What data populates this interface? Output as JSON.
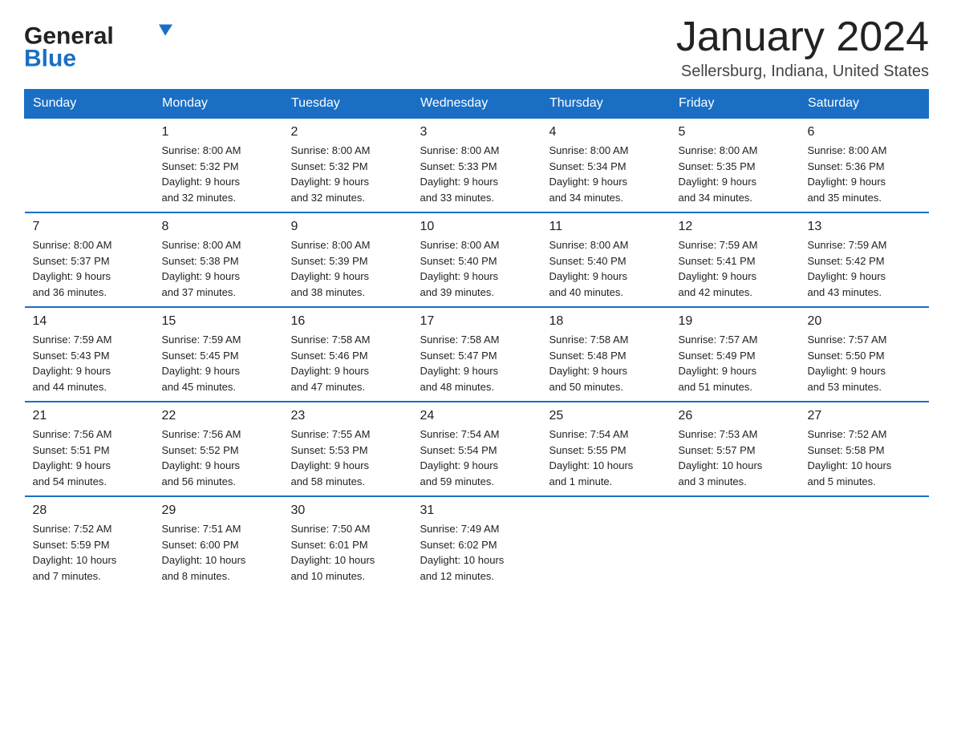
{
  "header": {
    "logo_general": "General",
    "logo_blue": "Blue",
    "month_title": "January 2024",
    "location": "Sellersburg, Indiana, United States"
  },
  "calendar": {
    "days_of_week": [
      "Sunday",
      "Monday",
      "Tuesday",
      "Wednesday",
      "Thursday",
      "Friday",
      "Saturday"
    ],
    "weeks": [
      [
        {
          "day": "",
          "info": ""
        },
        {
          "day": "1",
          "info": "Sunrise: 8:00 AM\nSunset: 5:32 PM\nDaylight: 9 hours\nand 32 minutes."
        },
        {
          "day": "2",
          "info": "Sunrise: 8:00 AM\nSunset: 5:32 PM\nDaylight: 9 hours\nand 32 minutes."
        },
        {
          "day": "3",
          "info": "Sunrise: 8:00 AM\nSunset: 5:33 PM\nDaylight: 9 hours\nand 33 minutes."
        },
        {
          "day": "4",
          "info": "Sunrise: 8:00 AM\nSunset: 5:34 PM\nDaylight: 9 hours\nand 34 minutes."
        },
        {
          "day": "5",
          "info": "Sunrise: 8:00 AM\nSunset: 5:35 PM\nDaylight: 9 hours\nand 34 minutes."
        },
        {
          "day": "6",
          "info": "Sunrise: 8:00 AM\nSunset: 5:36 PM\nDaylight: 9 hours\nand 35 minutes."
        }
      ],
      [
        {
          "day": "7",
          "info": "Sunrise: 8:00 AM\nSunset: 5:37 PM\nDaylight: 9 hours\nand 36 minutes."
        },
        {
          "day": "8",
          "info": "Sunrise: 8:00 AM\nSunset: 5:38 PM\nDaylight: 9 hours\nand 37 minutes."
        },
        {
          "day": "9",
          "info": "Sunrise: 8:00 AM\nSunset: 5:39 PM\nDaylight: 9 hours\nand 38 minutes."
        },
        {
          "day": "10",
          "info": "Sunrise: 8:00 AM\nSunset: 5:40 PM\nDaylight: 9 hours\nand 39 minutes."
        },
        {
          "day": "11",
          "info": "Sunrise: 8:00 AM\nSunset: 5:40 PM\nDaylight: 9 hours\nand 40 minutes."
        },
        {
          "day": "12",
          "info": "Sunrise: 7:59 AM\nSunset: 5:41 PM\nDaylight: 9 hours\nand 42 minutes."
        },
        {
          "day": "13",
          "info": "Sunrise: 7:59 AM\nSunset: 5:42 PM\nDaylight: 9 hours\nand 43 minutes."
        }
      ],
      [
        {
          "day": "14",
          "info": "Sunrise: 7:59 AM\nSunset: 5:43 PM\nDaylight: 9 hours\nand 44 minutes."
        },
        {
          "day": "15",
          "info": "Sunrise: 7:59 AM\nSunset: 5:45 PM\nDaylight: 9 hours\nand 45 minutes."
        },
        {
          "day": "16",
          "info": "Sunrise: 7:58 AM\nSunset: 5:46 PM\nDaylight: 9 hours\nand 47 minutes."
        },
        {
          "day": "17",
          "info": "Sunrise: 7:58 AM\nSunset: 5:47 PM\nDaylight: 9 hours\nand 48 minutes."
        },
        {
          "day": "18",
          "info": "Sunrise: 7:58 AM\nSunset: 5:48 PM\nDaylight: 9 hours\nand 50 minutes."
        },
        {
          "day": "19",
          "info": "Sunrise: 7:57 AM\nSunset: 5:49 PM\nDaylight: 9 hours\nand 51 minutes."
        },
        {
          "day": "20",
          "info": "Sunrise: 7:57 AM\nSunset: 5:50 PM\nDaylight: 9 hours\nand 53 minutes."
        }
      ],
      [
        {
          "day": "21",
          "info": "Sunrise: 7:56 AM\nSunset: 5:51 PM\nDaylight: 9 hours\nand 54 minutes."
        },
        {
          "day": "22",
          "info": "Sunrise: 7:56 AM\nSunset: 5:52 PM\nDaylight: 9 hours\nand 56 minutes."
        },
        {
          "day": "23",
          "info": "Sunrise: 7:55 AM\nSunset: 5:53 PM\nDaylight: 9 hours\nand 58 minutes."
        },
        {
          "day": "24",
          "info": "Sunrise: 7:54 AM\nSunset: 5:54 PM\nDaylight: 9 hours\nand 59 minutes."
        },
        {
          "day": "25",
          "info": "Sunrise: 7:54 AM\nSunset: 5:55 PM\nDaylight: 10 hours\nand 1 minute."
        },
        {
          "day": "26",
          "info": "Sunrise: 7:53 AM\nSunset: 5:57 PM\nDaylight: 10 hours\nand 3 minutes."
        },
        {
          "day": "27",
          "info": "Sunrise: 7:52 AM\nSunset: 5:58 PM\nDaylight: 10 hours\nand 5 minutes."
        }
      ],
      [
        {
          "day": "28",
          "info": "Sunrise: 7:52 AM\nSunset: 5:59 PM\nDaylight: 10 hours\nand 7 minutes."
        },
        {
          "day": "29",
          "info": "Sunrise: 7:51 AM\nSunset: 6:00 PM\nDaylight: 10 hours\nand 8 minutes."
        },
        {
          "day": "30",
          "info": "Sunrise: 7:50 AM\nSunset: 6:01 PM\nDaylight: 10 hours\nand 10 minutes."
        },
        {
          "day": "31",
          "info": "Sunrise: 7:49 AM\nSunset: 6:02 PM\nDaylight: 10 hours\nand 12 minutes."
        },
        {
          "day": "",
          "info": ""
        },
        {
          "day": "",
          "info": ""
        },
        {
          "day": "",
          "info": ""
        }
      ]
    ]
  }
}
